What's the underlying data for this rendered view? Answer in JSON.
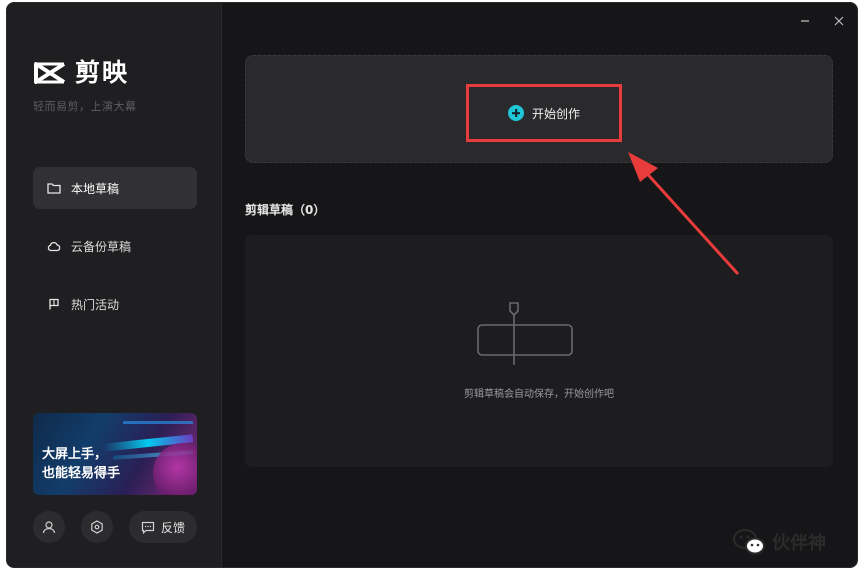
{
  "app": {
    "logo_text": "剪映",
    "slogan": "轻而易剪，上演大幕"
  },
  "sidebar": {
    "items": [
      {
        "label": "本地草稿",
        "icon": "folder-icon",
        "active": true
      },
      {
        "label": "云备份草稿",
        "icon": "cloud-icon",
        "active": false
      },
      {
        "label": "热门活动",
        "icon": "flag-icon",
        "active": false
      }
    ],
    "banner": {
      "line1": "大屏上手，",
      "line2": "也能轻易得手"
    },
    "bottom": {
      "account_icon": "user-icon",
      "settings_icon": "settings-icon",
      "feedback_icon": "chat-icon",
      "feedback_label": "反馈"
    }
  },
  "window_controls": {
    "minimize_icon": "minimize-icon",
    "close_icon": "close-icon"
  },
  "main": {
    "create_label": "开始创作",
    "drafts_title": "剪辑草稿（0）",
    "empty_text": "剪辑草稿会自动保存，开始创作吧"
  },
  "annotation": {
    "highlight_color": "#e83b3b"
  },
  "watermark": {
    "text": "伙伴神",
    "icon": "wechat-icon"
  },
  "colors": {
    "accent": "#1fc6d6",
    "background": "#161618",
    "sidebar": "#1f1f21"
  }
}
